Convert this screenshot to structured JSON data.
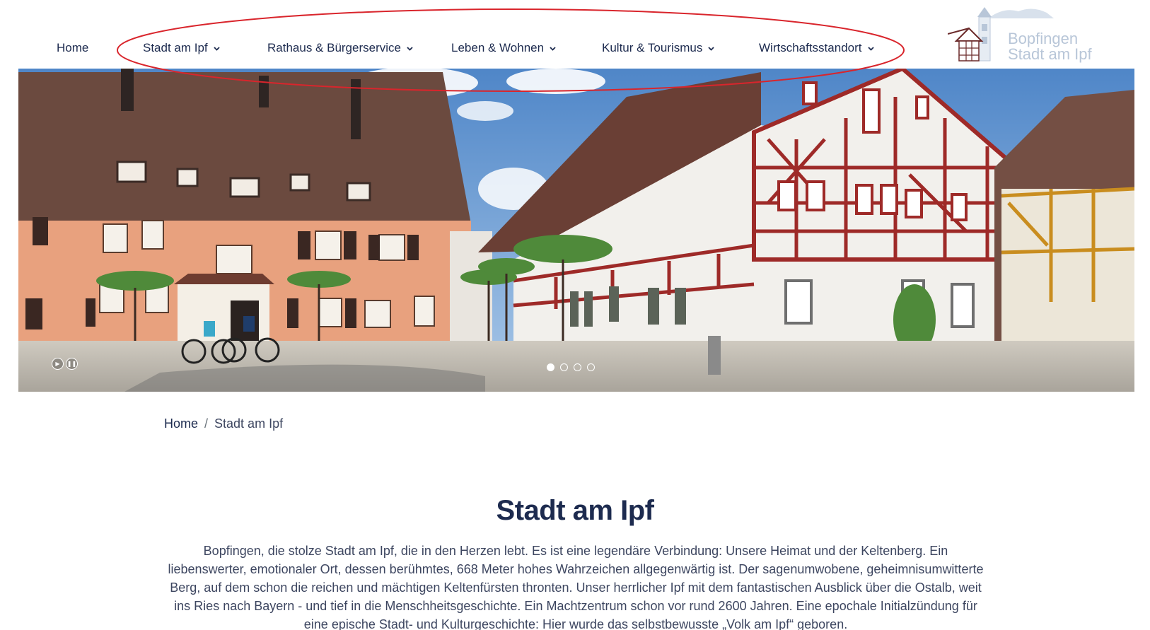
{
  "nav": {
    "items": [
      {
        "label": "Home",
        "has_dropdown": false
      },
      {
        "label": "Stadt am Ipf",
        "has_dropdown": true
      },
      {
        "label": "Rathaus & Bürgerservice",
        "has_dropdown": true
      },
      {
        "label": "Leben & Wohnen",
        "has_dropdown": true
      },
      {
        "label": "Kultur & Tourismus",
        "has_dropdown": true
      },
      {
        "label": "Wirtschaftsstandort",
        "has_dropdown": true
      }
    ],
    "annotation_color": "#d9252c"
  },
  "logo": {
    "line1": "Bopfingen",
    "line2": "Stadt am Ipf"
  },
  "slider": {
    "controls": [
      "play-icon",
      "pause-icon"
    ],
    "dots": 4,
    "active_dot": 1
  },
  "breadcrumb": {
    "home": "Home",
    "separator": "/",
    "current": "Stadt am Ipf"
  },
  "main": {
    "title": "Stadt am Ipf",
    "intro": "Bopfingen, die stolze Stadt am Ipf, die in den Herzen lebt. Es ist eine legendäre Verbindung: Unsere Heimat und der Keltenberg. Ein liebenswerter, emotionaler Ort, dessen berühmtes, 668 Meter hohes Wahrzeichen allgegenwärtig ist. Der sagenumwobene, geheimnisumwitterte Berg, auf dem schon die reichen und mächtigen Keltenfürsten thronten. Unser herrlicher Ipf mit dem fantastischen Ausblick über die Ostalb, weit ins Ries nach Bayern - und tief in die Menschheitsgeschichte. Ein Machtzentrum schon vor rund 2600 Jahren. Eine epochale Initialzündung für eine epische Stadt- und Kulturgeschichte: Hier wurde das selbstbewusste „Volk am Ipf“ geboren."
  },
  "colors": {
    "navy": "#1d2b4f",
    "text": "#3d4660",
    "timber_red": "#a3272a"
  }
}
